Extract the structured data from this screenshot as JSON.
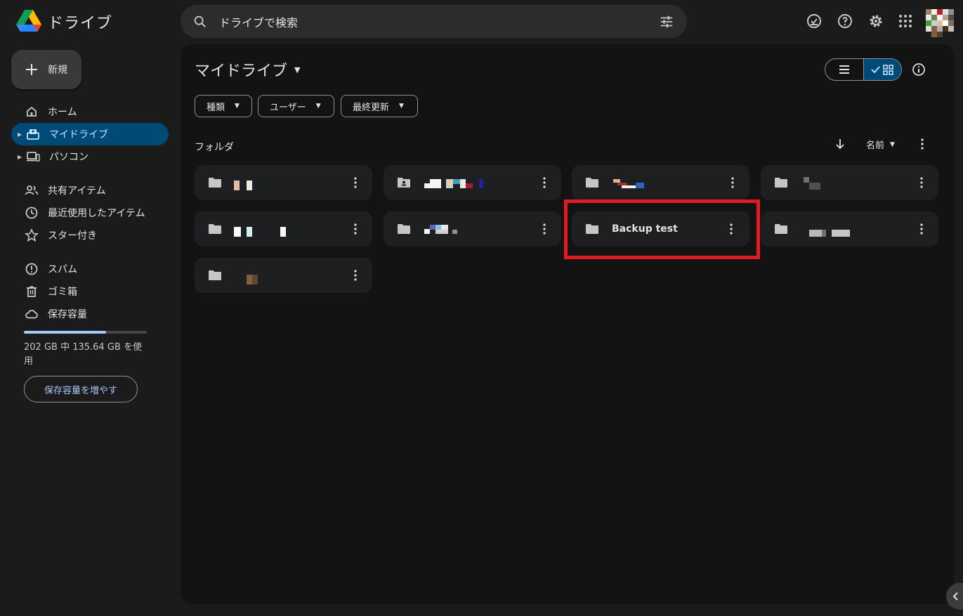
{
  "app": {
    "title": "ドライブ"
  },
  "search": {
    "placeholder": "ドライブで検索"
  },
  "header_icons": [
    "ready-offline-icon",
    "help-icon",
    "settings-icon",
    "apps-icon",
    "account-avatar"
  ],
  "sidebar": {
    "new_label": "新規",
    "items": [
      {
        "label": "ホーム",
        "icon": "home-icon"
      },
      {
        "label": "マイドライブ",
        "icon": "my-drive-icon",
        "active": true
      },
      {
        "label": "パソコン",
        "icon": "computers-icon"
      },
      {
        "label": "共有アイテム",
        "icon": "shared-icon"
      },
      {
        "label": "最近使用したアイテム",
        "icon": "recent-icon"
      },
      {
        "label": "スター付き",
        "icon": "star-icon"
      },
      {
        "label": "スパム",
        "icon": "spam-icon"
      },
      {
        "label": "ゴミ箱",
        "icon": "trash-icon"
      },
      {
        "label": "保存容量",
        "icon": "cloud-icon"
      }
    ],
    "storage": {
      "text": "202 GB 中 135.64 GB を使用",
      "used_fraction": 0.67,
      "button": "保存容量を増やす"
    }
  },
  "main": {
    "title": "マイドライブ",
    "filters": [
      "種類",
      "ユーザー",
      "最終更新"
    ],
    "section_label": "フォルダ",
    "sort_label": "名前",
    "folders": [
      {
        "name": "",
        "redacted": true
      },
      {
        "name": "",
        "redacted": true,
        "shared": true
      },
      {
        "name": "",
        "redacted": true
      },
      {
        "name": "",
        "redacted": true
      },
      {
        "name": "",
        "redacted": true
      },
      {
        "name": "",
        "redacted": true
      },
      {
        "name": "Backup test",
        "redacted": false,
        "highlighted": true
      },
      {
        "name": "",
        "redacted": true
      },
      {
        "name": "",
        "redacted": true
      }
    ]
  },
  "colors": {
    "background": "#1b1b1b",
    "panel": "#131314",
    "card": "#1e1f20",
    "active_nav": "#004a77",
    "highlight_box": "#e01b24",
    "accent": "#a8c7fa"
  }
}
